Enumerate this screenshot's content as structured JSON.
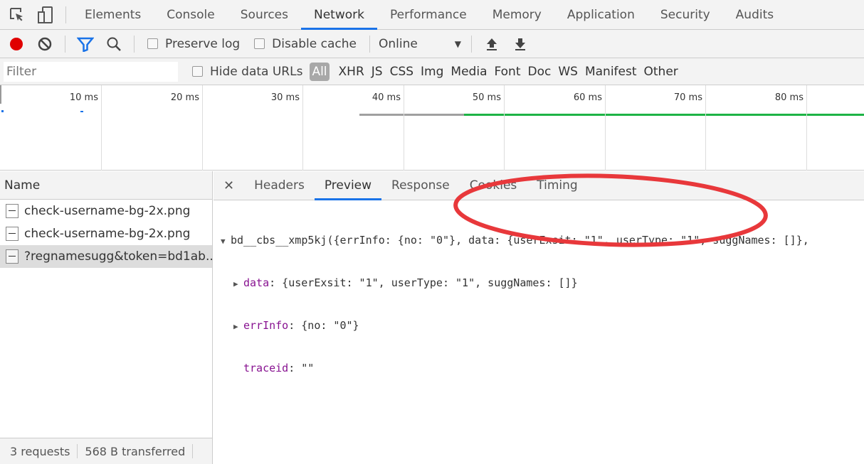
{
  "tabs": [
    "Elements",
    "Console",
    "Sources",
    "Network",
    "Performance",
    "Memory",
    "Application",
    "Security",
    "Audits"
  ],
  "active_tab": "Network",
  "toolbar": {
    "preserve_log": "Preserve log",
    "disable_cache": "Disable cache",
    "throttle": "Online"
  },
  "filter": {
    "placeholder": "Filter",
    "hide_data_urls": "Hide data URLs",
    "types": [
      "All",
      "XHR",
      "JS",
      "CSS",
      "Img",
      "Media",
      "Font",
      "Doc",
      "WS",
      "Manifest",
      "Other"
    ]
  },
  "timeline": {
    "ticks": [
      "10 ms",
      "20 ms",
      "30 ms",
      "40 ms",
      "50 ms",
      "60 ms",
      "70 ms",
      "80 ms"
    ]
  },
  "requests": {
    "header": "Name",
    "items": [
      "check-username-bg-2x.png",
      "check-username-bg-2x.png",
      "?regnamesugg&token=bd1ab..."
    ]
  },
  "status": {
    "requests": "3 requests",
    "transferred": "568 B transferred"
  },
  "detail_tabs": [
    "Headers",
    "Preview",
    "Response",
    "Cookies",
    "Timing"
  ],
  "preview": {
    "root": "bd__cbs__xmp5kj({errInfo: {no: \"0\"}, data: {userExsit: \"1\", userType: \"1\", suggNames: []},",
    "data_key": "data",
    "data_val": ": {userExsit: \"1\", userType: \"1\", suggNames: []}",
    "err_key": "errInfo",
    "err_val": ": {no: \"0\"}",
    "trace_key": "traceid",
    "trace_val": ": \"\""
  },
  "colors": {
    "accent": "#1a73e8",
    "record": "#e00000",
    "annotation": "#e8383b",
    "waterfall_wait": "#a0a0a0",
    "waterfall_receive": "#1db345"
  }
}
